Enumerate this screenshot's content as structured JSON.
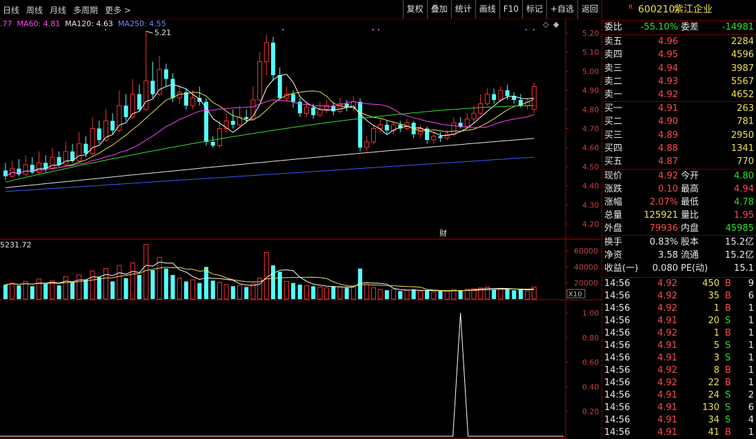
{
  "toolbar": {
    "periods": [
      "日线",
      "周线",
      "月线",
      "多周期",
      "更多 >"
    ],
    "buttons": [
      "复权",
      "叠加",
      "统计",
      "画线",
      "F10",
      "标记",
      "+自选",
      "返回"
    ]
  },
  "legend": {
    "ma_partial": ".77",
    "ma60": "MA60: 4.81",
    "ma120": "MA120: 4.63",
    "ma250": "MA250: 4.55",
    "colors": {
      "ma60": "#ff44ff",
      "ma120": "#e8e8e8",
      "ma250": "#3a5bff"
    }
  },
  "price_axis": [
    "5.20",
    "5.10",
    "5.00",
    "4.90",
    "4.80",
    "4.70",
    "4.60",
    "4.50",
    "4.40",
    "4.30",
    "4.20"
  ],
  "high_marker": "5.21",
  "finance_marker": "财",
  "volume_label": "5231.72",
  "volume_axis": [
    "60000",
    "40000",
    "20000"
  ],
  "volume_unit": "X10",
  "indicator_axis": [
    "1.00",
    "0.80",
    "0.60",
    "0.40",
    "0.20"
  ],
  "quote": {
    "code_prefix": "R",
    "code": "600210",
    "name": "紫江企业",
    "weibi_label": "委比",
    "weibi": "-55.10%",
    "weicha_label": "委差",
    "weicha": "-14981",
    "asks": [
      {
        "label": "卖五",
        "price": "4.96",
        "vol": "2284"
      },
      {
        "label": "卖四",
        "price": "4.95",
        "vol": "4596"
      },
      {
        "label": "卖三",
        "price": "4.94",
        "vol": "3987"
      },
      {
        "label": "卖二",
        "price": "4.93",
        "vol": "5567"
      },
      {
        "label": "卖一",
        "price": "4.92",
        "vol": "4652"
      }
    ],
    "bids": [
      {
        "label": "买一",
        "price": "4.91",
        "vol": "263"
      },
      {
        "label": "买二",
        "price": "4.90",
        "vol": "781"
      },
      {
        "label": "买三",
        "price": "4.89",
        "vol": "2950"
      },
      {
        "label": "买四",
        "price": "4.88",
        "vol": "1341"
      },
      {
        "label": "买五",
        "price": "4.87",
        "vol": "770"
      }
    ],
    "stats": [
      {
        "l1": "现价",
        "v1": "4.92",
        "c1": "red",
        "l2": "今开",
        "v2": "4.80",
        "c2": "green"
      },
      {
        "l1": "涨跌",
        "v1": "0.10",
        "c1": "red",
        "l2": "最高",
        "v2": "4.94",
        "c2": "red"
      },
      {
        "l1": "涨幅",
        "v1": "2.07%",
        "c1": "red",
        "l2": "最低",
        "v2": "4.78",
        "c2": "green"
      },
      {
        "l1": "总量",
        "v1": "125921",
        "c1": "yellow",
        "l2": "量比",
        "v2": "1.95",
        "c2": "red"
      },
      {
        "l1": "外盘",
        "v1": "79936",
        "c1": "red",
        "l2": "内盘",
        "v2": "45985",
        "c2": "green"
      }
    ],
    "info": [
      {
        "l1": "换手",
        "v1": "0.83%",
        "l2": "股本",
        "v2": "15.2亿"
      },
      {
        "l1": "净资",
        "v1": "3.58",
        "l2": "流通",
        "v2": "15.2亿"
      },
      {
        "l1": "收益(一)",
        "v1": "0.080",
        "l2": "PE(动)",
        "v2": "15.1"
      }
    ],
    "ticks": [
      {
        "time": "14:56",
        "price": "4.92",
        "vol": "450",
        "side": "B",
        "n": "9"
      },
      {
        "time": "14:56",
        "price": "4.92",
        "vol": "35",
        "side": "B",
        "n": "6"
      },
      {
        "time": "14:56",
        "price": "4.92",
        "vol": "1",
        "side": "B",
        "n": "1"
      },
      {
        "time": "14:56",
        "price": "4.91",
        "vol": "20",
        "side": "S",
        "n": "1"
      },
      {
        "time": "14:56",
        "price": "4.92",
        "vol": "1",
        "side": "B",
        "n": "1"
      },
      {
        "time": "14:56",
        "price": "4.91",
        "vol": "5",
        "side": "S",
        "n": "1"
      },
      {
        "time": "14:56",
        "price": "4.91",
        "vol": "3",
        "side": "S",
        "n": "1"
      },
      {
        "time": "14:56",
        "price": "4.92",
        "vol": "8",
        "side": "B",
        "n": "1"
      },
      {
        "time": "14:56",
        "price": "4.92",
        "vol": "22",
        "side": "B",
        "n": "1"
      },
      {
        "time": "14:56",
        "price": "4.91",
        "vol": "24",
        "side": "S",
        "n": "2"
      },
      {
        "time": "14:56",
        "price": "4.91",
        "vol": "130",
        "side": "S",
        "n": "6"
      },
      {
        "time": "14:56",
        "price": "4.91",
        "vol": "34",
        "side": "S",
        "n": "4"
      },
      {
        "time": "14:56",
        "price": "4.91",
        "vol": "41",
        "side": "B",
        "n": "1"
      }
    ]
  }
}
